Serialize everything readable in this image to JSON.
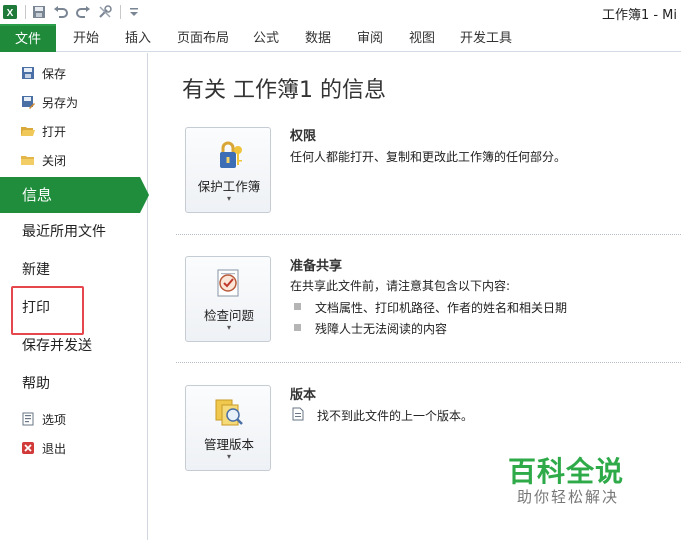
{
  "window": {
    "title": "工作簿1 - Mi"
  },
  "tabs": [
    {
      "label": "文件"
    },
    {
      "label": "开始"
    },
    {
      "label": "插入"
    },
    {
      "label": "页面布局"
    },
    {
      "label": "公式"
    },
    {
      "label": "数据"
    },
    {
      "label": "审阅"
    },
    {
      "label": "视图"
    },
    {
      "label": "开发工具"
    }
  ],
  "backstage": {
    "commands": [
      {
        "label": "保存",
        "icon": "save-icon"
      },
      {
        "label": "另存为",
        "icon": "save-as-icon"
      },
      {
        "label": "打开",
        "icon": "open-folder-icon"
      },
      {
        "label": "关闭",
        "icon": "close-folder-icon"
      }
    ],
    "active": {
      "label": "信息"
    },
    "nav": [
      {
        "label": "最近所用文件"
      },
      {
        "label": "新建"
      },
      {
        "label": "打印"
      },
      {
        "label": "保存并发送"
      },
      {
        "label": "帮助"
      }
    ],
    "bottom": [
      {
        "label": "选项",
        "icon": "options-icon"
      },
      {
        "label": "退出",
        "icon": "exit-icon"
      }
    ]
  },
  "info": {
    "title": "有关 工作簿1 的信息",
    "sections": [
      {
        "button": "保护工作簿",
        "title": "权限",
        "desc": "任何人都能打开、复制和更改此工作簿的任何部分。"
      },
      {
        "button": "检查问题",
        "title": "准备共享",
        "desc": "在共享此文件前，请注意其包含以下内容:",
        "bullets": [
          "文档属性、打印机路径、作者的姓名和相关日期",
          "残障人士无法阅读的内容"
        ]
      },
      {
        "button": "管理版本",
        "title": "版本",
        "desc": "找不到此文件的上一个版本。"
      }
    ],
    "dropdown_glyph": "▾"
  },
  "watermark": {
    "title": "百科全说",
    "subtitle": "助你轻松解决"
  },
  "colors": {
    "file_tab": "#1e8a3a",
    "active_nav": "#1f8d3c",
    "highlight_box": "#e5474c",
    "watermark": "#2eaa49"
  }
}
